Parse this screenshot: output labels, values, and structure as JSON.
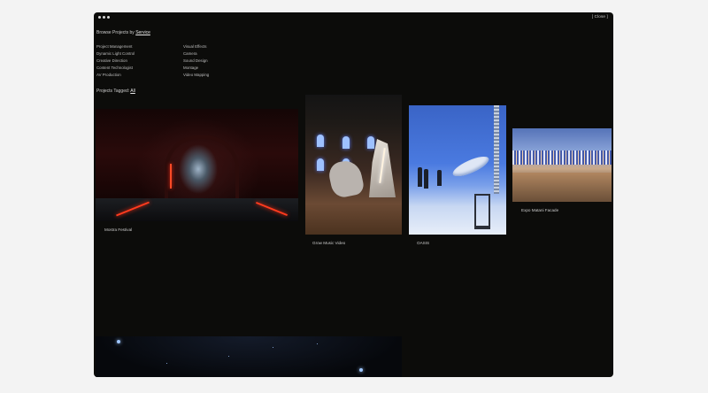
{
  "window": {
    "close_label": "[ Close ]"
  },
  "browse": {
    "prefix": "Browse Projects by",
    "link": "Service"
  },
  "services": {
    "col1": [
      "Project Management",
      "Dynamic Light Control",
      "Creative Direction",
      "Content Technologist",
      "AV Production"
    ],
    "col2": [
      "Visual Effects",
      "Camera",
      "Sound Design",
      "Montage",
      "Video Mapping"
    ]
  },
  "tagged": {
    "prefix": "Projects Tagged:",
    "link": "All"
  },
  "projects": [
    {
      "title": "Mostra Festival"
    },
    {
      "title": "Grow Music Video"
    },
    {
      "title": "OASIS"
    },
    {
      "title": "Expo Matani Facade"
    },
    {
      "title": ""
    }
  ],
  "colors": {
    "page_background": "#f3f3f3",
    "panel_background": "#0c0c0a",
    "text": "#cfcfcf"
  }
}
